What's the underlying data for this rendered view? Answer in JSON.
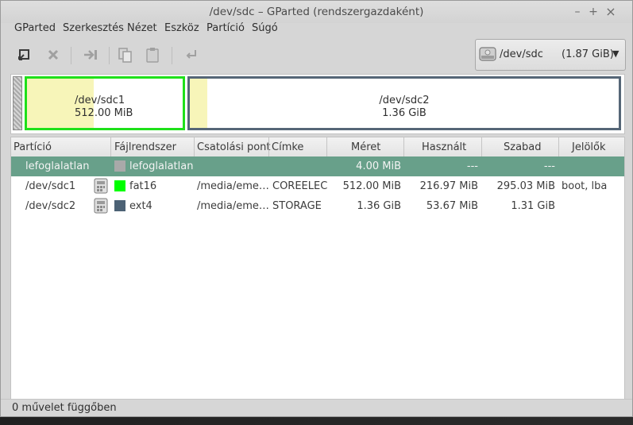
{
  "window": {
    "title": "/dev/sdc – GParted (rendszergazdaként)",
    "controls": {
      "minimize": "–",
      "maximize": "+",
      "close": "×"
    }
  },
  "menu": [
    "GParted",
    "Szerkesztés",
    "Nézet",
    "Eszköz",
    "Partíció",
    "Súgó"
  ],
  "toolbar": {
    "icons": [
      "new-partition-icon",
      "delete-icon",
      "resize-move-icon",
      "copy-icon",
      "paste-icon",
      "undo-icon"
    ]
  },
  "device": {
    "name": "/dev/sdc",
    "size": "(1.87 GiB)"
  },
  "diskmap": {
    "p1": {
      "name": "/dev/sdc1",
      "size": "512.00 MiB",
      "border": "#1fe01a"
    },
    "p2": {
      "name": "/dev/sdc2",
      "size": "1.36 GiB",
      "border": "#556677"
    }
  },
  "table": {
    "headers": [
      "Partíció",
      "Fájlrendszer",
      "Csatolási pont",
      "Címke",
      "Méret",
      "Használt",
      "Szabad",
      "Jelölők"
    ],
    "rows": [
      {
        "partition": "lefoglalatlan",
        "fs": "lefoglalatlan",
        "fs_color": "#a9a9a9",
        "mount": "",
        "label": "",
        "size": "4.00 MiB",
        "used": "---",
        "free": "---",
        "flags": "",
        "lock": false,
        "selected": true
      },
      {
        "partition": "/dev/sdc1",
        "fs": "fat16",
        "fs_color": "#00ff00",
        "mount": "/media/eme…",
        "label": "COREELEC",
        "size": "512.00 MiB",
        "used": "216.97 MiB",
        "free": "295.03 MiB",
        "flags": "boot, lba",
        "lock": true,
        "selected": false
      },
      {
        "partition": "/dev/sdc2",
        "fs": "ext4",
        "fs_color": "#4c6275",
        "mount": "/media/eme…",
        "label": "STORAGE",
        "size": "1.36 GiB",
        "used": "53.67 MiB",
        "free": "1.31 GiB",
        "flags": "",
        "lock": true,
        "selected": false
      }
    ]
  },
  "status": {
    "text": "0 művelet függőben"
  }
}
